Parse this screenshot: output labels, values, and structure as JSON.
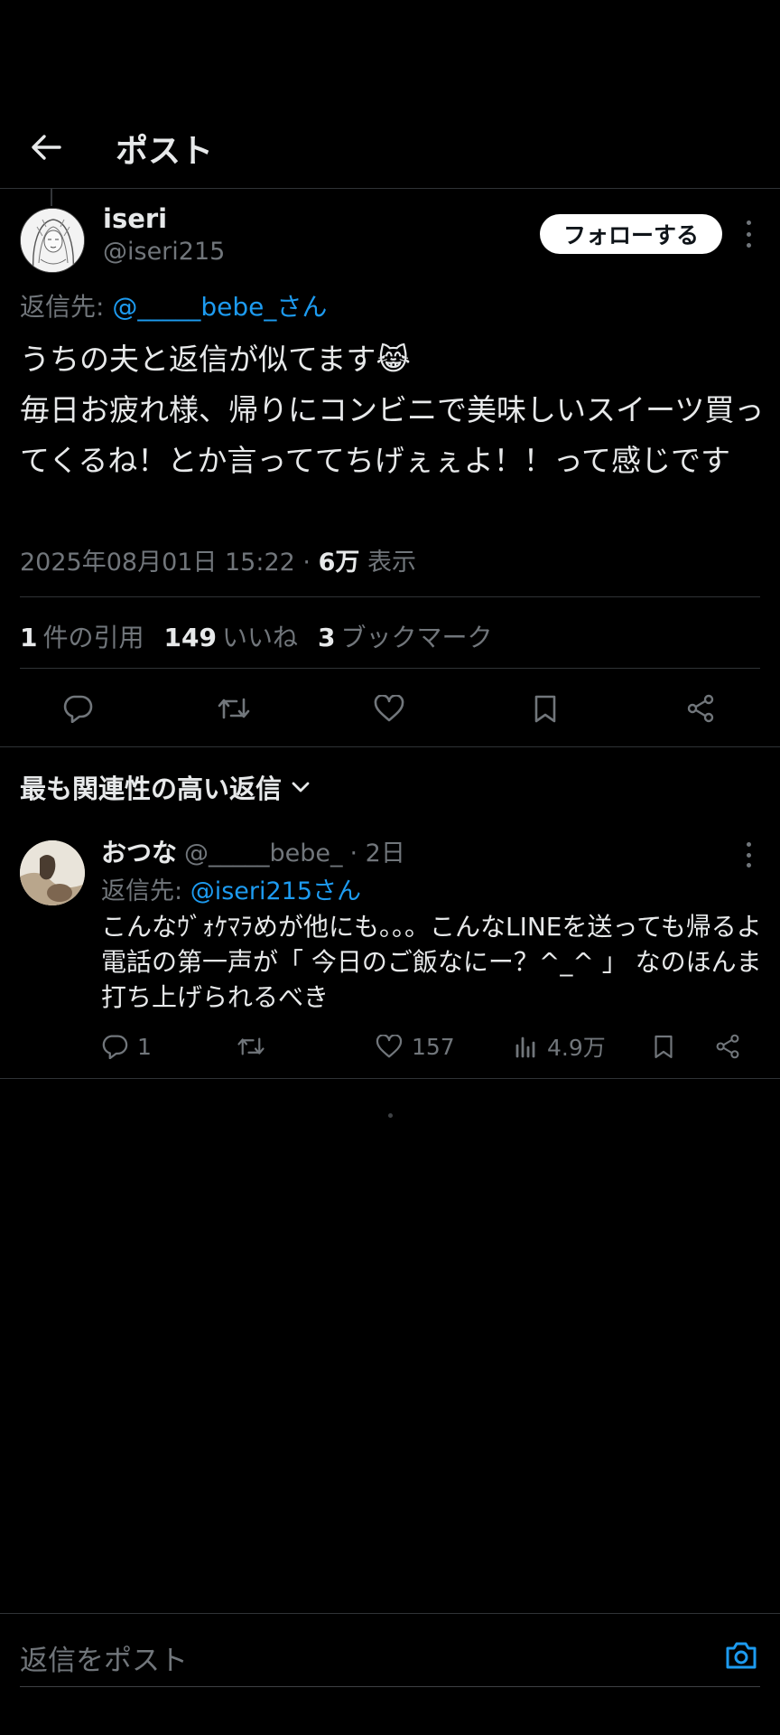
{
  "header": {
    "back_icon": "arrow-left-icon",
    "title": "ポスト"
  },
  "post": {
    "author_name": "iseri",
    "author_handle": "@iseri215",
    "follow_label": "フォローする",
    "reply_prefix": "返信先:",
    "reply_target": "@_____bebe_さん",
    "text": "うちの夫と返信が似てます😹\n毎日お疲れ様、帰りにコンビニで美味しいスイーツ買ってくるね！とか言っててちげぇぇよ！！って感じです",
    "timestamp": "2025年08月01日 15:22",
    "separator": "·",
    "views": "6万",
    "views_label": "表示",
    "stats": {
      "quotes_count": "1",
      "quotes_label": "件の引用",
      "likes_count": "149",
      "likes_label": "いいね",
      "bookmarks_count": "3",
      "bookmarks_label": "ブックマーク"
    }
  },
  "sort": {
    "label": "最も関連性の高い返信"
  },
  "reply": {
    "name": "おつな",
    "handle": "@_____bebe_",
    "time": "· 2日",
    "reply_prefix": "返信先:",
    "reply_target": "@iseri215さん",
    "text": "こんなｳﾞｫｹﾏﾗめが他にも。。。こんなLINEを送っても帰るよ電話の第一声が「 今日のご飯なにー？^_^ 」 なのほんま打ち上げられるべき",
    "replies": "1",
    "likes": "157",
    "views": "4.9万"
  },
  "composer": {
    "placeholder": "返信をポスト"
  },
  "colors": {
    "background": "#000000",
    "text": "#e7e9ea",
    "muted": "#71767b",
    "link": "#1d9bf0",
    "divider": "#2f3336"
  }
}
